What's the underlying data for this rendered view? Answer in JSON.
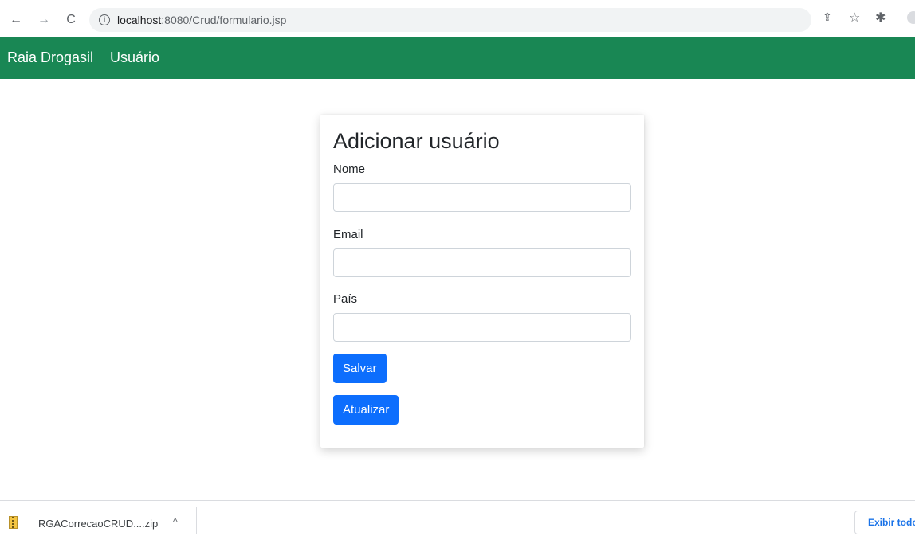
{
  "browser": {
    "url_host": "localhost",
    "url_rest": ":8080/Crud/formulario.jsp",
    "back_icon": "←",
    "forward_icon": "→",
    "reload_icon": "C",
    "info_icon": "i",
    "share_icon": "⇪",
    "star_icon": "☆",
    "extension_icon": "✱"
  },
  "navbar": {
    "brand": "Raia Drogasil",
    "links": [
      {
        "label": "Usuário"
      }
    ],
    "color": "#198754"
  },
  "form": {
    "title": "Adicionar usuário",
    "fields": [
      {
        "label": "Nome",
        "value": ""
      },
      {
        "label": "Email",
        "value": ""
      },
      {
        "label": "País",
        "value": ""
      }
    ],
    "buttons": [
      {
        "label": "Salvar"
      },
      {
        "label": "Atualizar"
      }
    ],
    "button_color": "#0d6efd"
  },
  "downloads": {
    "file_name": "RGACorrecaoCRUD....zip",
    "chevron": "^",
    "show_all_label": "Exibir todos"
  }
}
